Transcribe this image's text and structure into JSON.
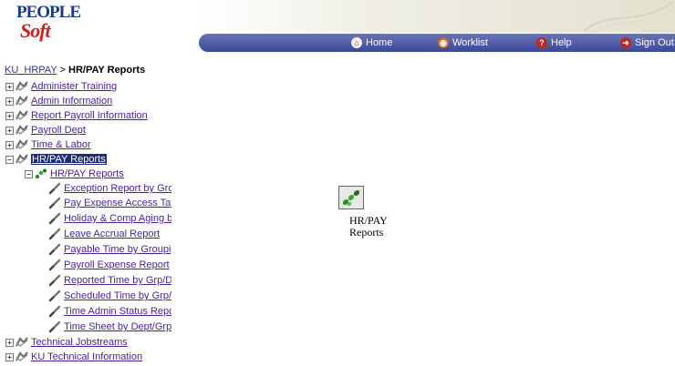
{
  "header": {
    "logo_top": "PEOPLE",
    "logo_bottom": "Soft",
    "nav": [
      {
        "label": "Home",
        "icon": "home-icon"
      },
      {
        "label": "Worklist",
        "icon": "worklist-icon"
      },
      {
        "label": "Help",
        "icon": "help-icon"
      },
      {
        "label": "Sign Out",
        "icon": "sign-out-icon"
      }
    ]
  },
  "breadcrumb": {
    "parent": "KU_HRPAY",
    "separator": ">",
    "current": "HR/PAY Reports"
  },
  "tree": {
    "top_items": [
      {
        "label": "Administer Training",
        "expanded": false
      },
      {
        "label": "Admin Information",
        "expanded": false
      },
      {
        "label": "Report Payroll Information",
        "expanded": false
      },
      {
        "label": "Payroll Dept",
        "expanded": false
      },
      {
        "label": "Time & Labor",
        "expanded": false
      },
      {
        "label": "HR/PAY Reports",
        "expanded": true,
        "selected": true
      }
    ],
    "sub_folder": {
      "label": "HR/PAY Reports",
      "expanded": true
    },
    "reports": [
      "Exception Report by Gro",
      "Pay Expense Access Tal",
      "Holiday & Comp Aging b",
      "Leave Accrual Report",
      "Payable Time by Groupi",
      "Payroll Expense Report",
      "Reported Time by Grp/D",
      "Scheduled Time by Grp/",
      "Time Admin Status Repo",
      "Time Sheet by Dept/Grp/"
    ],
    "bottom_items": [
      {
        "label": "Technical Jobstreams",
        "expanded": false
      },
      {
        "label": "KU Technical Information",
        "expanded": false
      }
    ]
  },
  "content": {
    "icon_label_line1": "HR/PAY",
    "icon_label_line2": "Reports"
  },
  "colors": {
    "nav_bar": "#4e5aa3",
    "link": "#4a22a0",
    "selected_bg": "#1c2a7c",
    "logo_blue": "#1a3a8a",
    "logo_red": "#d21f1f"
  }
}
